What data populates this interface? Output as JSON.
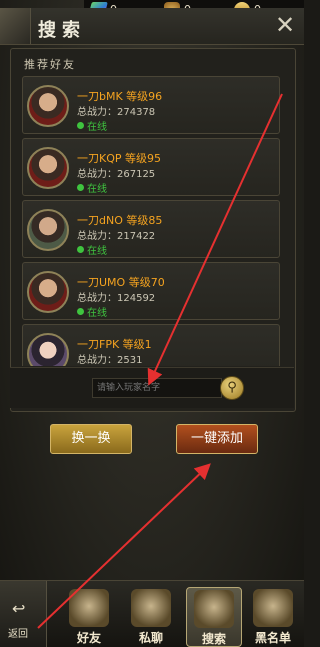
{
  "resources": [
    {
      "icon": "gem-icon",
      "value": "0"
    },
    {
      "icon": "money-bag-icon",
      "value": "0"
    },
    {
      "icon": "gold-ingot-icon",
      "value": "0"
    }
  ],
  "header": {
    "title": "搜索"
  },
  "section_label": "推荐好友",
  "friends": [
    {
      "name": "一刀bMK  等级96",
      "power": "总战力：274378",
      "status": "在线"
    },
    {
      "name": "一刀KQP  等级95",
      "power": "总战力：267125",
      "status": "在线"
    },
    {
      "name": "一刀dNO  等级85",
      "power": "总战力：217422",
      "status": "在线"
    },
    {
      "name": "一刀UMO  等级70",
      "power": "总战力：124592",
      "status": "在线"
    },
    {
      "name": "一刀FPK  等级1",
      "power": "总战力：2531",
      "status": ""
    }
  ],
  "search": {
    "placeholder": "请输入玩家名字"
  },
  "buttons": {
    "swap": "换一换",
    "add_all": "一键添加"
  },
  "nav": {
    "back": "返回",
    "tabs": [
      {
        "label": "好友"
      },
      {
        "label": "私聊"
      },
      {
        "label": "搜索"
      },
      {
        "label": "黑名单"
      }
    ]
  },
  "colors": {
    "name": "#f4a320",
    "online": "#3fc43f",
    "annotation": "#e53030"
  }
}
